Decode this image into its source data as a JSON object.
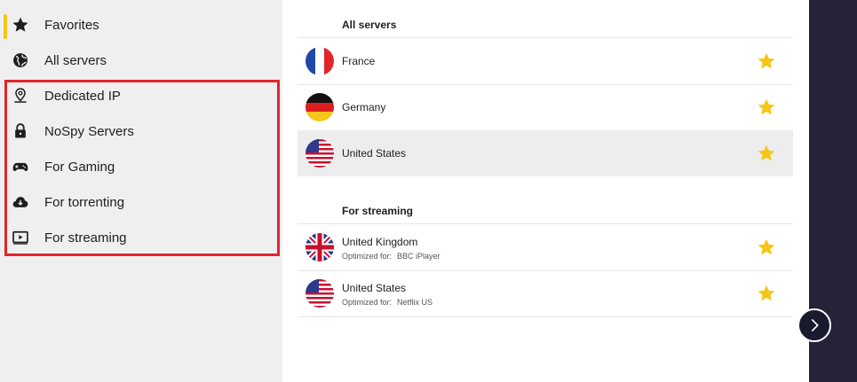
{
  "sidebar": {
    "items": [
      {
        "label": "Favorites",
        "icon": "star-icon",
        "active": true
      },
      {
        "label": "All servers",
        "icon": "globe-icon"
      },
      {
        "label": "Dedicated IP",
        "icon": "location-pin-icon"
      },
      {
        "label": "NoSpy Servers",
        "icon": "lock-icon"
      },
      {
        "label": "For Gaming",
        "icon": "gamepad-icon"
      },
      {
        "label": "For torrenting",
        "icon": "cloud-download-icon"
      },
      {
        "label": "For streaming",
        "icon": "play-screen-icon"
      }
    ]
  },
  "main": {
    "sections": [
      {
        "title": "All servers",
        "servers": [
          {
            "name": "France",
            "flag": "france-flag-icon"
          },
          {
            "name": "Germany",
            "flag": "germany-flag-icon"
          },
          {
            "name": "United States",
            "flag": "usa-flag-icon"
          }
        ]
      },
      {
        "title": "For streaming",
        "servers": [
          {
            "name": "United Kingdom",
            "optimized_label": "Optimized for:",
            "optimized_for": "BBC iPlayer",
            "flag": "uk-flag-icon"
          },
          {
            "name": "United States",
            "optimized_label": "Optimized for:",
            "optimized_for": "Netflix US",
            "flag": "usa-flag-icon"
          }
        ]
      }
    ]
  },
  "colors": {
    "accent": "#f5c518",
    "highlight": "#e1252c",
    "sidebar_bg": "#efefef",
    "right_panel": "#242338"
  }
}
